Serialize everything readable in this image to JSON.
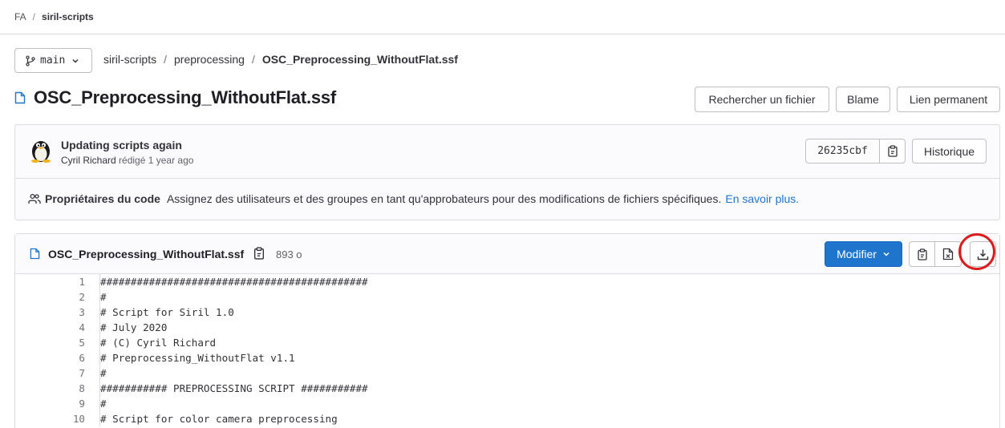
{
  "topbar": {
    "group": "FA",
    "separator": "/",
    "project": "siril-scripts"
  },
  "branch": {
    "name": "main"
  },
  "path": {
    "root": "siril-scripts",
    "folder": "preprocessing",
    "file": "OSC_Preprocessing_WithoutFlat.ssf",
    "separator": "/"
  },
  "title": "OSC_Preprocessing_WithoutFlat.ssf",
  "actions": {
    "find_file": "Rechercher un fichier",
    "blame": "Blame",
    "permalink": "Lien permanent"
  },
  "commit": {
    "message": "Updating scripts again",
    "author": "Cyril Richard",
    "verb": "rédigé",
    "time": "1 year ago",
    "sha": "26235cbf",
    "history_label": "Historique"
  },
  "owners": {
    "label": "Propriétaires du code",
    "text": "Assignez des utilisateurs et des groupes en tant qu'approbateurs pour des modifications de fichiers spécifiques.",
    "link": "En savoir plus."
  },
  "file": {
    "name": "OSC_Preprocessing_WithoutFlat.ssf",
    "size": "893 o",
    "modify_label": "Modifier"
  },
  "code_lines": [
    {
      "n": "1",
      "text": "############################################"
    },
    {
      "n": "2",
      "text": "#"
    },
    {
      "n": "3",
      "text": "# Script for Siril 1.0"
    },
    {
      "n": "4",
      "text": "# July 2020"
    },
    {
      "n": "5",
      "text": "# (C) Cyril Richard"
    },
    {
      "n": "6",
      "text": "# Preprocessing_WithoutFlat v1.1"
    },
    {
      "n": "7",
      "text": "#"
    },
    {
      "n": "8",
      "text": "########### PREPROCESSING SCRIPT ###########"
    },
    {
      "n": "9",
      "text": "#"
    },
    {
      "n": "10",
      "text": "# Script for color camera preprocessing"
    }
  ],
  "colors": {
    "accent": "#1f75cb",
    "highlight_circle": "#d91d1d"
  }
}
